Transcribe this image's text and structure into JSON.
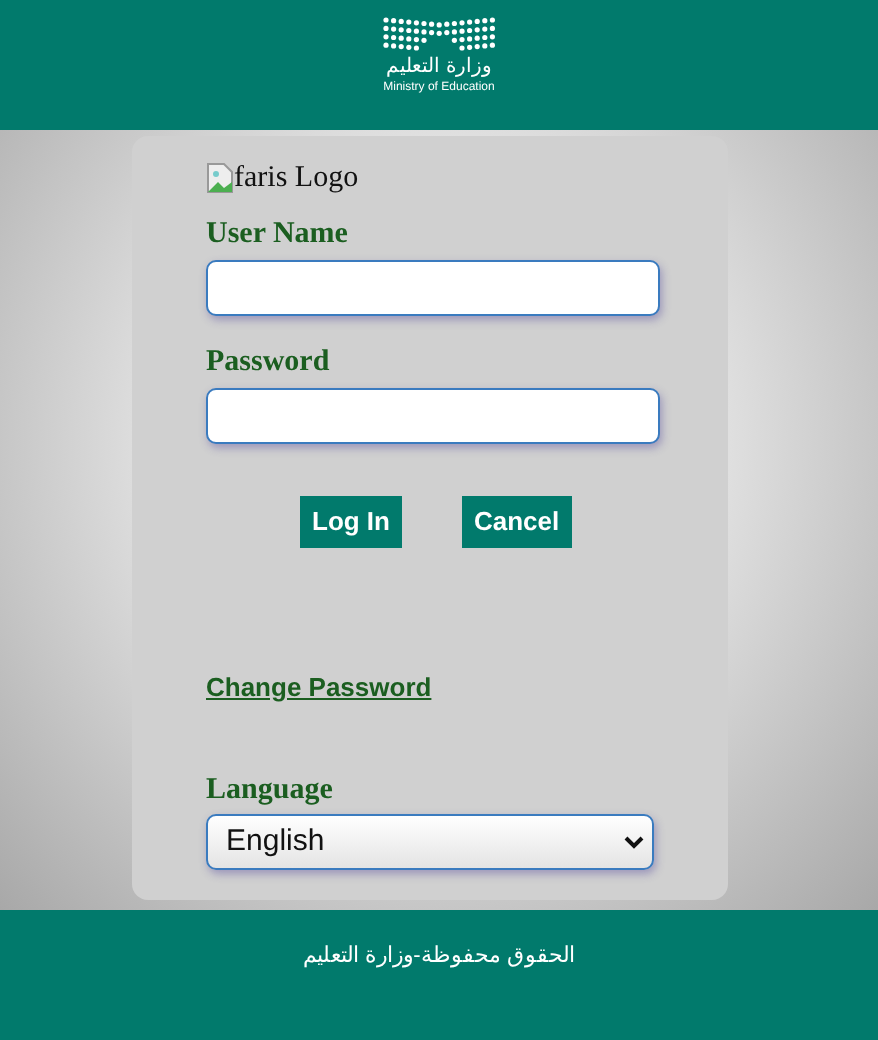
{
  "header": {
    "logo_arabic": "وزارة التعليم",
    "logo_english": "Ministry of Education"
  },
  "login": {
    "logo_alt": "faris Logo",
    "fields": [
      {
        "label": "User Name"
      },
      {
        "label": "Password"
      }
    ],
    "buttons": [
      "Log In",
      "Cancel"
    ],
    "change_password_link": "Change Password",
    "language": {
      "label": "Language",
      "value": "English"
    }
  },
  "footer": {
    "text": "الحقوق محفوظة-وزارة التعليم"
  }
}
